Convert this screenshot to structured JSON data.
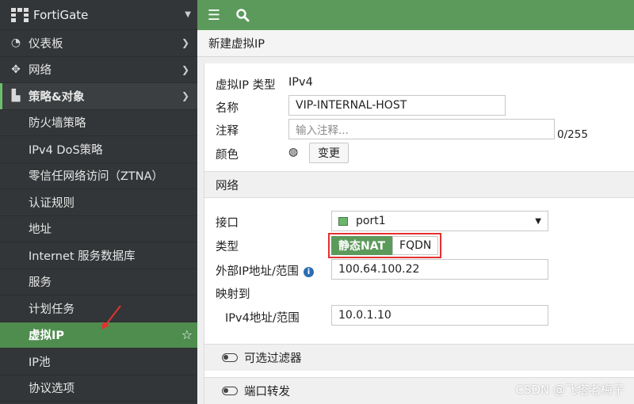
{
  "brand": {
    "name": "FortiGate"
  },
  "sidebar": {
    "items": [
      {
        "label": "仪表板",
        "icon": "dashboard-icon"
      },
      {
        "label": "网络",
        "icon": "network-icon"
      },
      {
        "label": "策略&对象",
        "icon": "policy-icon"
      }
    ],
    "sub_items": [
      "防火墙策略",
      "IPv4 DoS策略",
      "零信任网络访问（ZTNA）",
      "认证规则",
      "地址",
      "Internet 服务数据库",
      "服务",
      "计划任务",
      "虚拟IP",
      "IP池",
      "协议选项"
    ],
    "active": "虚拟IP"
  },
  "page": {
    "title": "新建虚拟IP"
  },
  "form": {
    "vip_type_label": "虚拟IP 类型",
    "vip_type_value": "IPv4",
    "name_label": "名称",
    "name_value": "VIP-INTERNAL-HOST",
    "comment_label": "注释",
    "comment_placeholder": "输入注释...",
    "comment_counter": "0/255",
    "color_label": "颜色",
    "color_button": "变更"
  },
  "network": {
    "section_label": "网络",
    "interface_label": "接口",
    "interface_value": "port1",
    "type_label": "类型",
    "type_options": [
      "静态NAT",
      "FQDN"
    ],
    "type_selected": "静态NAT",
    "external_label": "外部IP地址/范围",
    "external_value": "100.64.100.22",
    "mapped_label": "映射到",
    "ipv4_label": "IPv4地址/范围",
    "ipv4_value": "10.0.1.10"
  },
  "toggles": {
    "filter_label": "可选过滤器",
    "port_forward_label": "端口转发"
  },
  "watermark": "CSDN @飞塔老梅子",
  "colors": {
    "accent": "#5c9a5c",
    "sidebar": "#333638",
    "highlight_box": "#e53030"
  }
}
